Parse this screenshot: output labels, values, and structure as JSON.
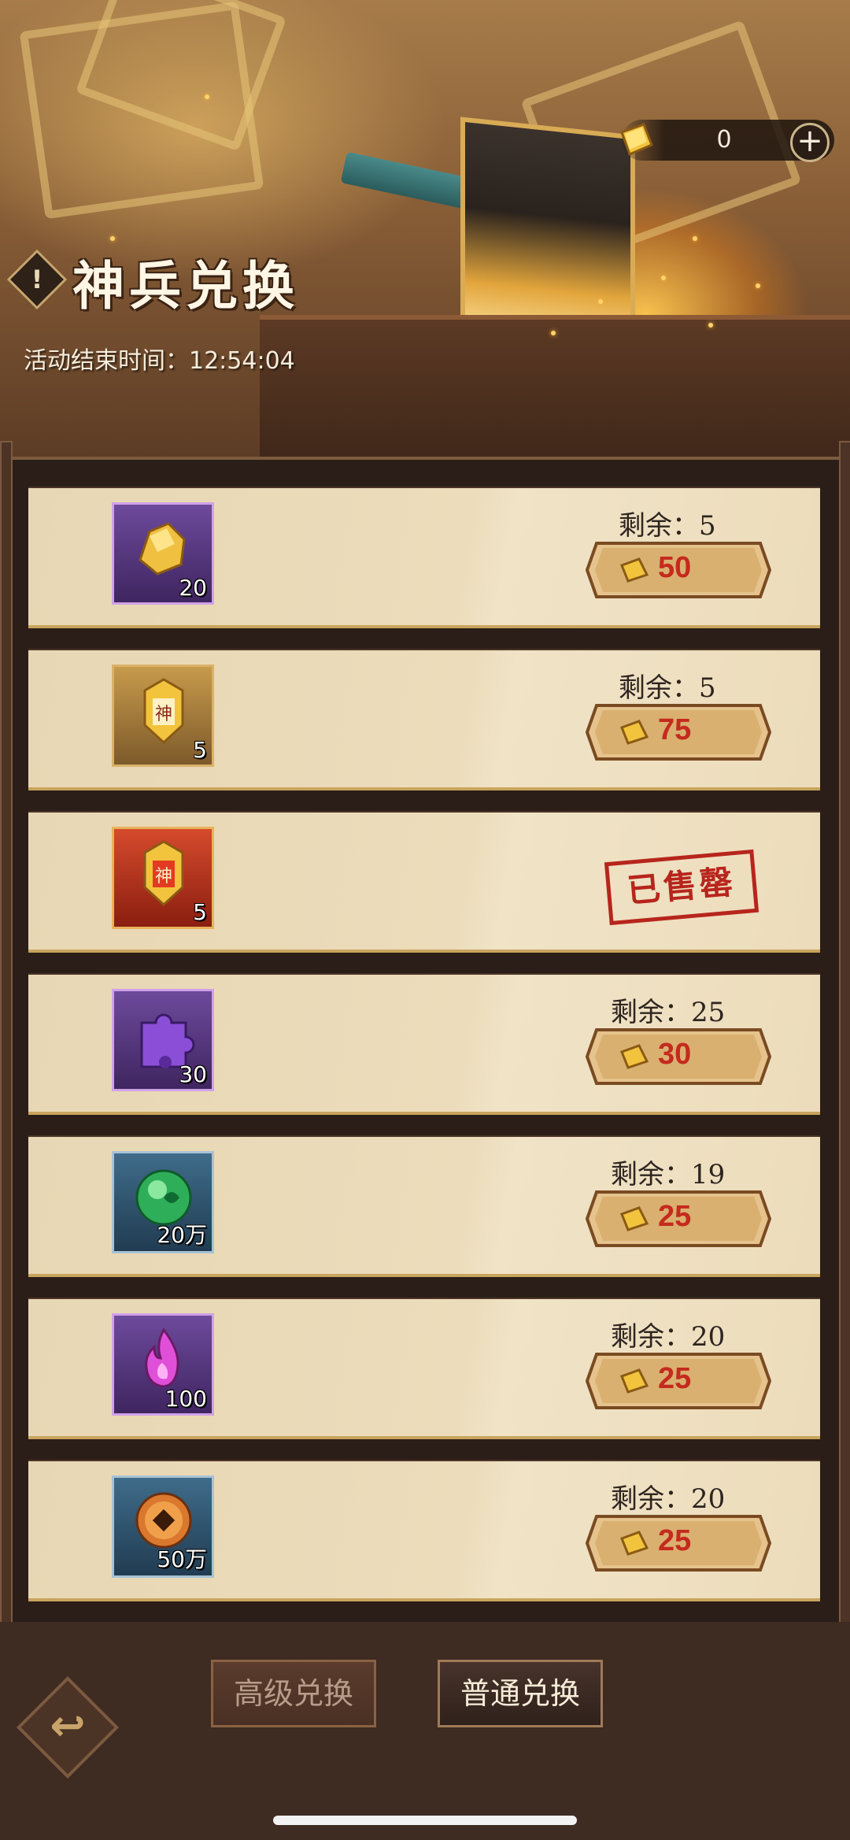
{
  "header": {
    "currency": {
      "icon": "gold-ingot-icon",
      "amount": "0",
      "add_icon": "plus-icon"
    },
    "title": "神兵兑换",
    "title_badge": "!",
    "timer_label": "活动结束时间：",
    "timer_value": "12:54:04"
  },
  "items": [
    {
      "icon": "gold-ore-icon",
      "frame": "purple",
      "qty": "20",
      "remain_label": "剩余：",
      "remain": "5",
      "price": "50",
      "sold_out": false
    },
    {
      "icon": "divine-token-gold-icon",
      "frame": "gold",
      "qty": "5",
      "remain_label": "剩余：",
      "remain": "5",
      "price": "75",
      "sold_out": false
    },
    {
      "icon": "divine-token-red-icon",
      "frame": "red",
      "qty": "5",
      "sold_out": true,
      "sold_out_label": "已售罄"
    },
    {
      "icon": "puzzle-piece-icon",
      "frame": "purple",
      "qty": "30",
      "remain_label": "剩余：",
      "remain": "25",
      "price": "30",
      "sold_out": false
    },
    {
      "icon": "jade-orb-icon",
      "frame": "blue",
      "qty": "20万",
      "remain_label": "剩余：",
      "remain": "19",
      "price": "25",
      "sold_out": false
    },
    {
      "icon": "purple-flame-icon",
      "frame": "purple",
      "qty": "100",
      "remain_label": "剩余：",
      "remain": "20",
      "price": "25",
      "sold_out": false
    },
    {
      "icon": "copper-coin-icon",
      "frame": "blue",
      "qty": "50万",
      "remain_label": "剩余：",
      "remain": "20",
      "price": "25",
      "sold_out": false
    }
  ],
  "bottom": {
    "tab_advanced": "高级兑换",
    "tab_normal": "普通兑换",
    "back_icon": "back-arrow-icon"
  },
  "colors": {
    "price": "#c52a1e",
    "accent_gold": "#d9ab55",
    "sold_out": "#b7251c"
  }
}
